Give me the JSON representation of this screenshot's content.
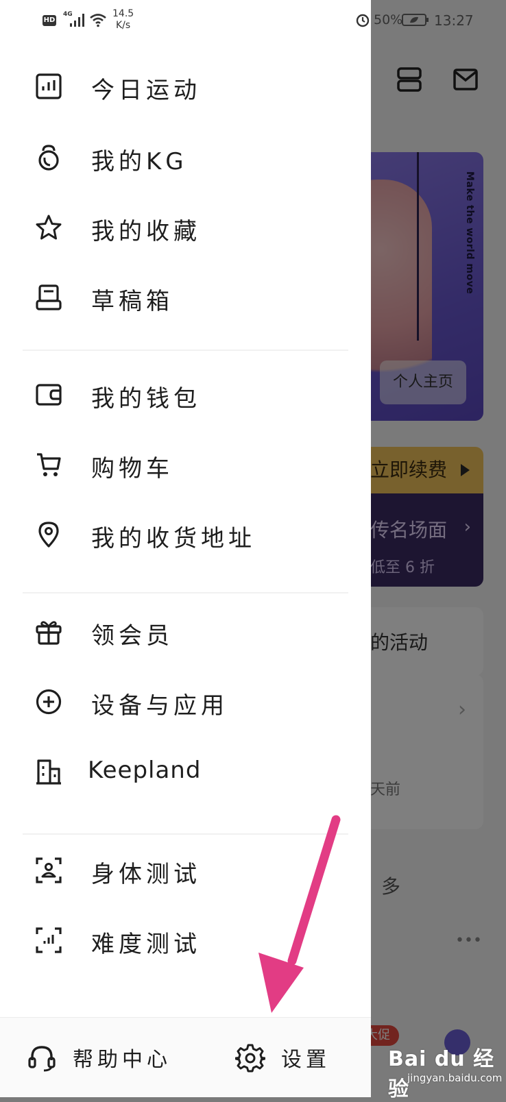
{
  "status_bar": {
    "hd": "HD",
    "network": "4G",
    "speed_value": "14.5",
    "speed_unit": "K/s",
    "battery": "50%",
    "time": "13:27"
  },
  "background": {
    "hero_slogan": "Make the world move",
    "hero_button": "个人主页",
    "renew_label": "立即续费",
    "promo_title": "传名场面",
    "promo_sub": "低至 6 折",
    "activity_label": "的活动",
    "days_ago": "天前",
    "more_label": "多",
    "badge_label": "大促"
  },
  "drawer": {
    "group1": [
      {
        "label": "今日运动",
        "icon": "chart-bars-icon"
      },
      {
        "label": "我的KG",
        "icon": "kettlebell-icon"
      },
      {
        "label": "我的收藏",
        "icon": "star-icon"
      },
      {
        "label": "草稿箱",
        "icon": "drafts-box-icon"
      }
    ],
    "group2": [
      {
        "label": "我的钱包",
        "icon": "wallet-icon"
      },
      {
        "label": "购物车",
        "icon": "cart-icon"
      },
      {
        "label": "我的收货地址",
        "icon": "location-pin-icon"
      }
    ],
    "group3": [
      {
        "label": "领会员",
        "icon": "gift-icon"
      },
      {
        "label": "设备与应用",
        "icon": "plus-circle-icon"
      },
      {
        "label": "Keepland",
        "icon": "building-icon"
      }
    ],
    "group4": [
      {
        "label": "身体测试",
        "icon": "body-scan-icon"
      },
      {
        "label": "难度测试",
        "icon": "difficulty-scan-icon"
      }
    ],
    "bottom": {
      "help": "帮助中心",
      "settings": "设置"
    }
  },
  "watermark": {
    "logo": "Bai du 经验",
    "url": "jingyan.baidu.com"
  },
  "colors": {
    "arrow": "#e23c84",
    "hero": "#6857cf",
    "renew": "#f1c35a",
    "promo": "#3b2b63"
  }
}
